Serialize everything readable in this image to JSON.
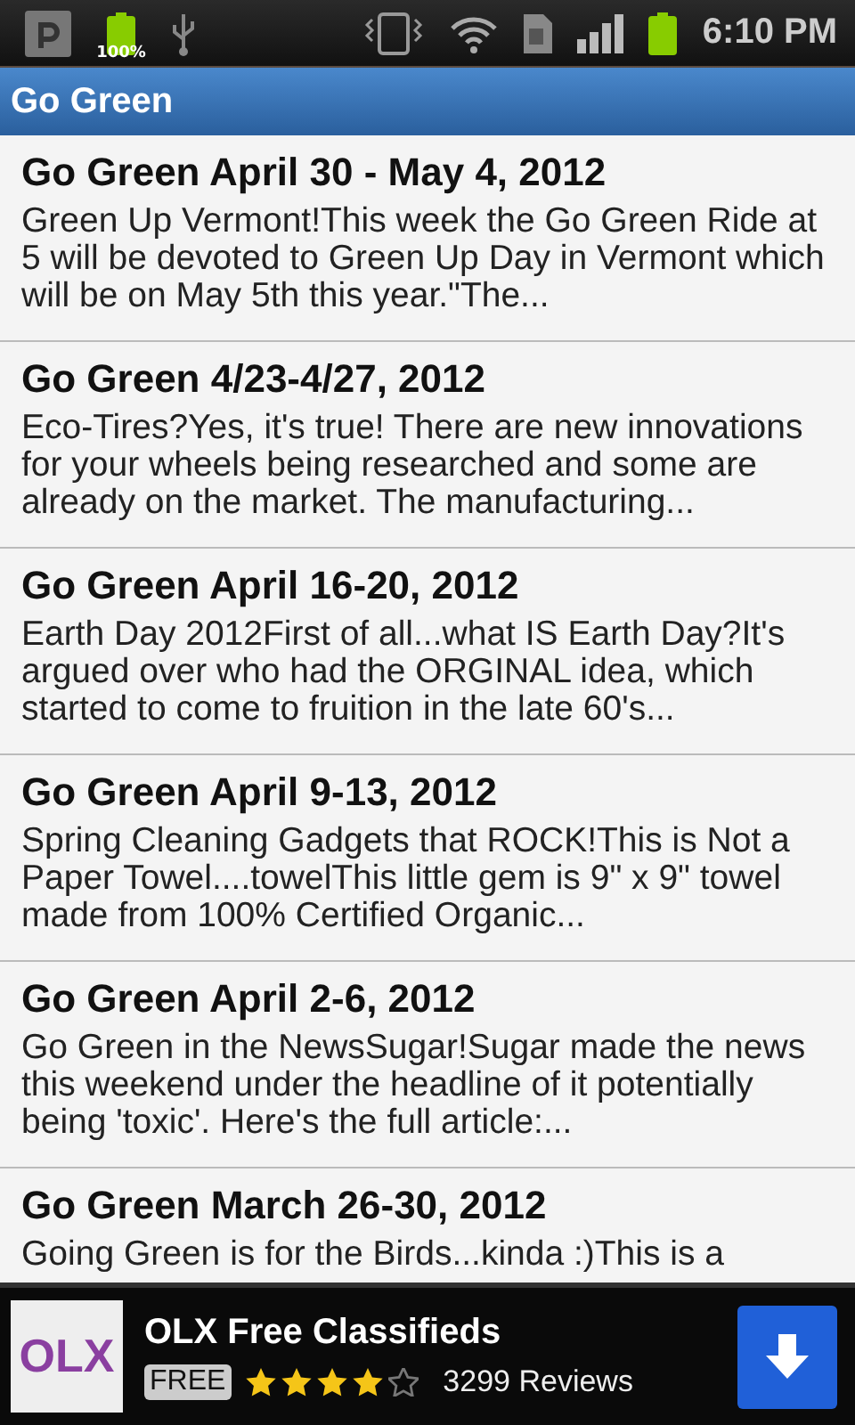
{
  "status_bar": {
    "battery_text": "100%",
    "time": "6:10 PM"
  },
  "title_bar": {
    "title": "Go Green"
  },
  "posts": [
    {
      "title": "Go Green April 30 - May 4, 2012",
      "excerpt": "Green Up Vermont!This week the Go Green Ride at 5 will be devoted to Green Up Day in Vermont which will be on May 5th this year.\"The..."
    },
    {
      "title": "Go Green 4/23-4/27, 2012",
      "excerpt": "Eco-Tires?Yes, it's true! There are new innovations for your wheels being researched and some are already on the market. The manufacturing..."
    },
    {
      "title": "Go Green April 16-20, 2012",
      "excerpt": "Earth Day 2012First of all...what IS Earth Day?It's argued over who had the ORGINAL idea, which started to come to fruition in the late 60's..."
    },
    {
      "title": "Go Green April 9-13, 2012",
      "excerpt": "Spring Cleaning Gadgets that ROCK!This is Not a Paper Towel....towelThis little gem is 9\" x 9\" towel made from 100% Certified Organic..."
    },
    {
      "title": "Go Green April 2-6, 2012",
      "excerpt": "Go Green in the NewsSugar!Sugar made the news this weekend under the headline of it potentially being 'toxic'. Here's the full article:..."
    },
    {
      "title": "Go Green March 26-30, 2012",
      "excerpt": "Going Green is for the Birds...kinda :)This is a"
    }
  ],
  "ad": {
    "logo": "OLX",
    "title": "OLX Free Classifieds",
    "price": "FREE",
    "stars": 4,
    "reviews": "3299 Reviews"
  }
}
